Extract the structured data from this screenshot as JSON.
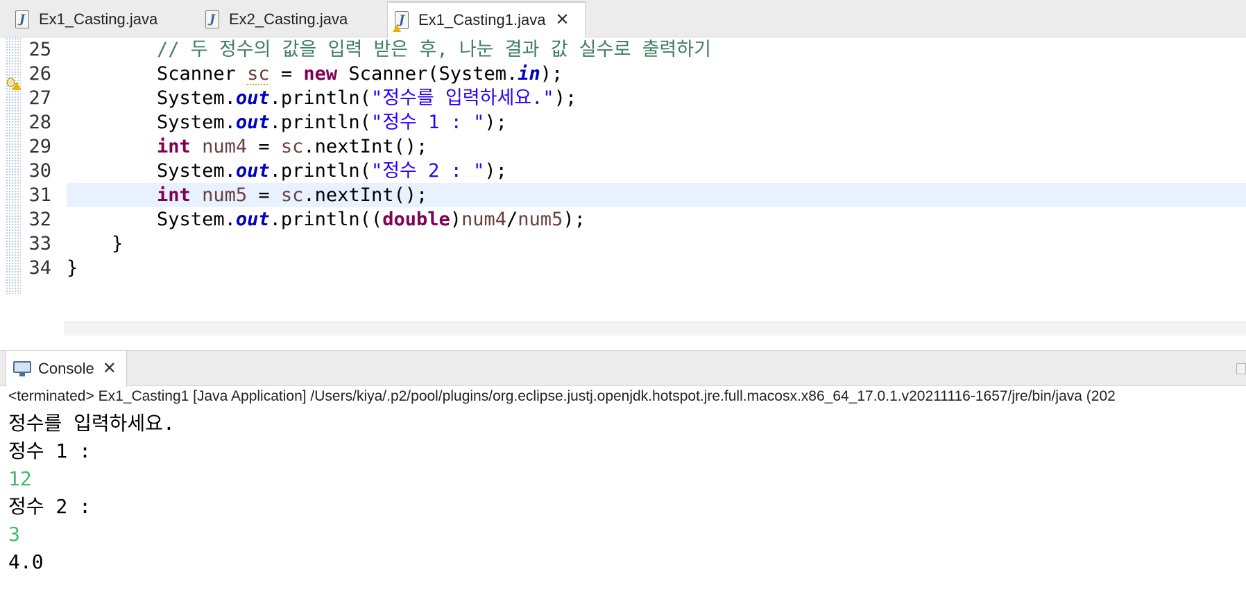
{
  "editor": {
    "tabs": [
      {
        "label": "Ex1_Casting.java",
        "active": false,
        "warning": false
      },
      {
        "label": "Ex2_Casting.java",
        "active": false,
        "warning": false
      },
      {
        "label": "Ex1_Casting1.java",
        "active": true,
        "warning": true
      }
    ],
    "tab_close_symbol": "✕",
    "file_icon_letter": "J",
    "current_line": 30,
    "lines": [
      {
        "number": "25",
        "tokens": [
          {
            "t": "        ",
            "c": ""
          },
          {
            "t": "// 두 정수의 값을 입력 받은 후, 나눈 결과 값 실수로 출력하기",
            "c": "cmt"
          }
        ]
      },
      {
        "number": "26",
        "tokens": [
          {
            "t": "        Scanner ",
            "c": ""
          },
          {
            "t": "sc",
            "c": "warnvar"
          },
          {
            "t": " = ",
            "c": ""
          },
          {
            "t": "new",
            "c": "kw"
          },
          {
            "t": " Scanner(System.",
            "c": ""
          },
          {
            "t": "in",
            "c": "fld"
          },
          {
            "t": ");",
            "c": ""
          }
        ]
      },
      {
        "number": "27",
        "tokens": [
          {
            "t": "        System.",
            "c": ""
          },
          {
            "t": "out",
            "c": "fld"
          },
          {
            "t": ".println(",
            "c": ""
          },
          {
            "t": "\"정수를 입력하세요.\"",
            "c": "str"
          },
          {
            "t": ");",
            "c": ""
          }
        ]
      },
      {
        "number": "28",
        "tokens": [
          {
            "t": "        System.",
            "c": ""
          },
          {
            "t": "out",
            "c": "fld"
          },
          {
            "t": ".println(",
            "c": ""
          },
          {
            "t": "\"정수 1 : \"",
            "c": "str"
          },
          {
            "t": ");",
            "c": ""
          }
        ]
      },
      {
        "number": "29",
        "tokens": [
          {
            "t": "        ",
            "c": ""
          },
          {
            "t": "int",
            "c": "kw"
          },
          {
            "t": " ",
            "c": ""
          },
          {
            "t": "num4",
            "c": "var"
          },
          {
            "t": " = ",
            "c": ""
          },
          {
            "t": "sc",
            "c": "var"
          },
          {
            "t": ".nextInt();",
            "c": ""
          }
        ]
      },
      {
        "number": "30",
        "tokens": [
          {
            "t": "        System.",
            "c": ""
          },
          {
            "t": "out",
            "c": "fld"
          },
          {
            "t": ".println(",
            "c": ""
          },
          {
            "t": "\"정수 2 : \"",
            "c": "str"
          },
          {
            "t": ");",
            "c": ""
          }
        ]
      },
      {
        "number": "31",
        "tokens": [
          {
            "t": "        ",
            "c": ""
          },
          {
            "t": "int",
            "c": "kw"
          },
          {
            "t": " ",
            "c": ""
          },
          {
            "t": "num5",
            "c": "var"
          },
          {
            "t": " = ",
            "c": ""
          },
          {
            "t": "sc",
            "c": "var"
          },
          {
            "t": ".nextInt();",
            "c": ""
          }
        ]
      },
      {
        "number": "32",
        "tokens": [
          {
            "t": "        System.",
            "c": ""
          },
          {
            "t": "out",
            "c": "fld"
          },
          {
            "t": ".println((",
            "c": ""
          },
          {
            "t": "double",
            "c": "kw"
          },
          {
            "t": ")",
            "c": ""
          },
          {
            "t": "num4",
            "c": "var"
          },
          {
            "t": "/",
            "c": ""
          },
          {
            "t": "num5",
            "c": "var"
          },
          {
            "t": ");",
            "c": ""
          }
        ]
      },
      {
        "number": "33",
        "tokens": [
          {
            "t": "    }",
            "c": ""
          }
        ]
      },
      {
        "number": "34",
        "tokens": [
          {
            "t": "}",
            "c": ""
          }
        ]
      }
    ]
  },
  "console": {
    "tab_label": "Console",
    "close_symbol": "✕",
    "status": "<terminated> Ex1_Casting1 [Java Application] /Users/kiya/.p2/pool/plugins/org.eclipse.justj.openjdk.hotspot.jre.full.macosx.x86_64_17.0.1.v20211116-1657/jre/bin/java  (202",
    "output": [
      {
        "text": "정수를 입력하세요.",
        "input": false
      },
      {
        "text": "정수 1 :",
        "input": false
      },
      {
        "text": "12",
        "input": true
      },
      {
        "text": "정수 2 :",
        "input": false
      },
      {
        "text": "3",
        "input": true
      },
      {
        "text": "4.0",
        "input": false
      }
    ]
  },
  "colors": {
    "keyword": "#7f0055",
    "string": "#2a00ff",
    "static_field": "#0000c0",
    "comment": "#3f7f5f",
    "local_variable": "#6a3e3e",
    "console_input": "#3dbb6b",
    "current_line_highlight": "#e8f2fe"
  }
}
